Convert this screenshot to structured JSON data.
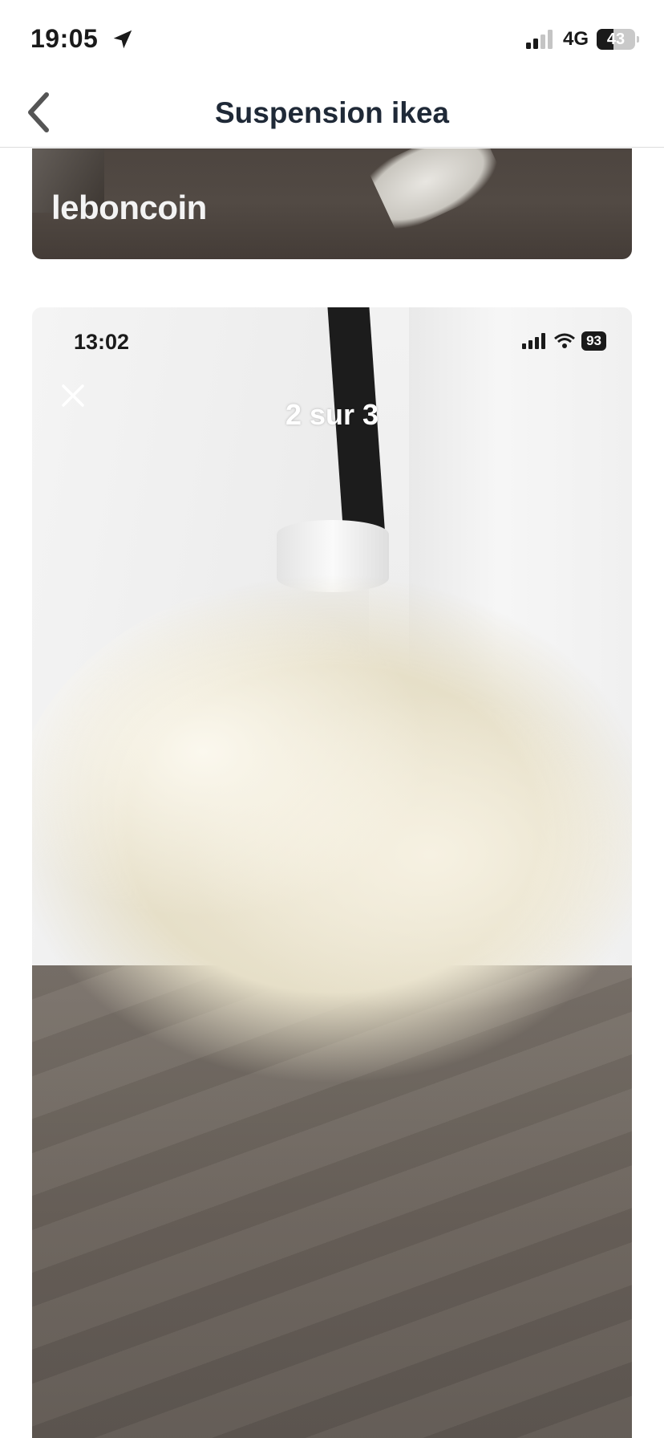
{
  "status_bar": {
    "time": "19:05",
    "network": "4G",
    "battery": "43",
    "battery_level": 0.43
  },
  "nav": {
    "title": "Suspension ikea"
  },
  "photos": [
    {
      "watermark": "leboncoin"
    },
    {
      "inner_status_time": "13:02",
      "inner_battery": "93",
      "counter": "2 sur 3"
    }
  ],
  "colors": {
    "title": "#1f2937",
    "background": "#ffffff",
    "divider": "#dcdcdc"
  },
  "icons": [
    "location-arrow-icon",
    "cellular-signal-icon",
    "battery-icon",
    "chevron-left-icon",
    "close-icon",
    "wifi-icon"
  ]
}
